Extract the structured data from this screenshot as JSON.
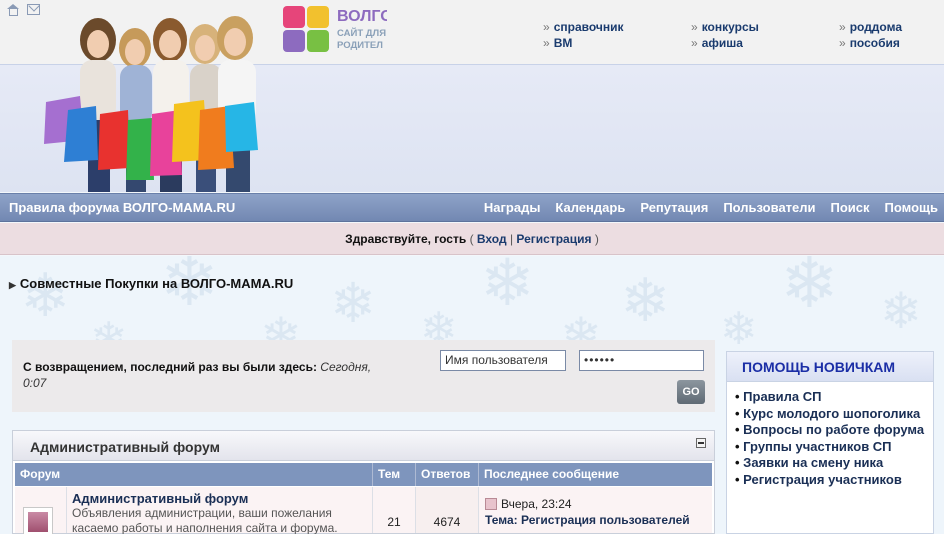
{
  "header": {
    "logo": {
      "brand": "ВОЛГО",
      "tagline_line1": "САЙТ ДЛЯ",
      "tagline_line2": "РОДИТЕЛ",
      "letters": "ВМ"
    },
    "top_links": [
      [
        "справочник",
        "ВМ"
      ],
      [
        "конкурсы",
        "афиша"
      ],
      [
        "роддома",
        "пособия"
      ]
    ]
  },
  "navbar": {
    "rules": "Правила форума ВОЛГО-МАМА.RU",
    "links": [
      "Награды",
      "Календарь",
      "Репутация",
      "Пользователи",
      "Поиск",
      "Помощь"
    ]
  },
  "welcome": {
    "greeting": "Здравствуйте, гость",
    "open_paren": "(",
    "login": "Вход",
    "separator": "|",
    "register": "Регистрация",
    "close_paren": ")"
  },
  "breadcrumb": {
    "title": "Совместные Покупки на ВОЛГО-МАМА.RU"
  },
  "login_box": {
    "message": "С возвращением, последний раз вы были здесь:",
    "last_visit": "Сегодня, 0:07",
    "username_placeholder": "Имя пользователя",
    "password_value": "••••••",
    "go_label": "GO"
  },
  "forum": {
    "section_title": "Административный форум",
    "columns": [
      "Форум",
      "Тем",
      "Ответов",
      "Последнее сообщение"
    ],
    "rows": [
      {
        "name": "Административный форум",
        "description": "Объявления администрации, ваши пожелания касаемо работы и наполнения сайта и форума. Глюки",
        "topics": "21",
        "replies": "4674",
        "last_when": "Вчера, 23:24",
        "last_topic_prefix": "Тема:",
        "last_topic": "Регистрация пользователей"
      }
    ]
  },
  "sidebar": {
    "title": "ПОМОЩЬ НОВИЧКАМ",
    "items": [
      "Правила СП",
      "Курс молодого шопоголика",
      "Вопросы по работе форума",
      "Группы участников СП",
      "Заявки на смену ника",
      "Регистрация участников"
    ]
  },
  "colors": {
    "navbar": "#7e95bd",
    "welcome_bar": "#ecdde1",
    "link": "#1a3b6e",
    "sidebar_title": "#1b2ea6"
  }
}
